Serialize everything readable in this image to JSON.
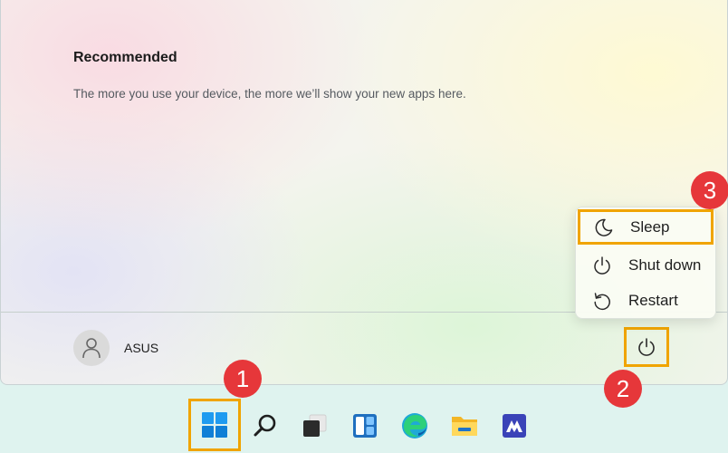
{
  "start_menu": {
    "recommended_title": "Recommended",
    "recommended_description": "The more you use your device, the more we’ll show your new apps here.",
    "user_name": "ASUS"
  },
  "power_menu": {
    "items": [
      {
        "label": "Sleep",
        "icon": "moon-icon"
      },
      {
        "label": "Shut down",
        "icon": "power-icon"
      },
      {
        "label": "Restart",
        "icon": "restart-icon"
      }
    ]
  },
  "callouts": [
    "1",
    "2",
    "3"
  ],
  "taskbar": {
    "icons": [
      "windows-start-icon",
      "search-icon",
      "task-view-icon",
      "widgets-icon",
      "edge-icon",
      "file-explorer-icon",
      "store-icon"
    ]
  },
  "colors": {
    "highlight": "#f0a400",
    "badge": "#e6373a"
  }
}
